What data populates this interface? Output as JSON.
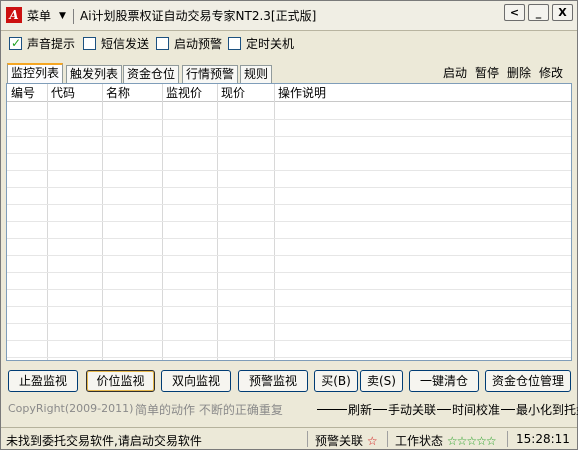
{
  "titlebar": {
    "menu_label": "菜单",
    "title": "Ai计划股票权证自动交易专家NT2.3[正式版]",
    "btn_back": "<",
    "btn_min": "_",
    "btn_close": "X"
  },
  "options": [
    {
      "label": "声音提示",
      "checked": true
    },
    {
      "label": "短信发送",
      "checked": false
    },
    {
      "label": "启动预警",
      "checked": false
    },
    {
      "label": "定时关机",
      "checked": false
    }
  ],
  "tabs": [
    "监控列表",
    "触发列表",
    "资金仓位",
    "行情预警",
    "规则"
  ],
  "actions": [
    "启动",
    "暂停",
    "删除",
    "修改"
  ],
  "table": {
    "columns": [
      "编号",
      "代码",
      "名称",
      "监视价",
      "现价",
      "操作说明"
    ],
    "rows": []
  },
  "buttons": {
    "stop_profit": "止盈监视",
    "price_monitor": "价位监视",
    "two_way": "双向监视",
    "alert_monitor": "预警监视",
    "buy": "买(B)",
    "sell": "卖(S)",
    "clear_all": "一键清仓",
    "fund_manage": "资金仓位管理"
  },
  "footer": {
    "copyright": "CopyRight(2009-2011)",
    "slogan": "简单的动作 不断的正确重复",
    "refresh": "刷新",
    "manual_link": "手动关联",
    "time_sync": "时间校准",
    "minimize_tray": "最小化到托盘"
  },
  "status": {
    "message": "未找到委托交易软件,请启动交易软件",
    "alert_link": "预警关联",
    "work_state": "工作状态",
    "time": "15:28:11"
  },
  "colors": {
    "accent_red": "#cc1010",
    "star_green": "#22a022",
    "tab_highlight": "#f5a623"
  }
}
